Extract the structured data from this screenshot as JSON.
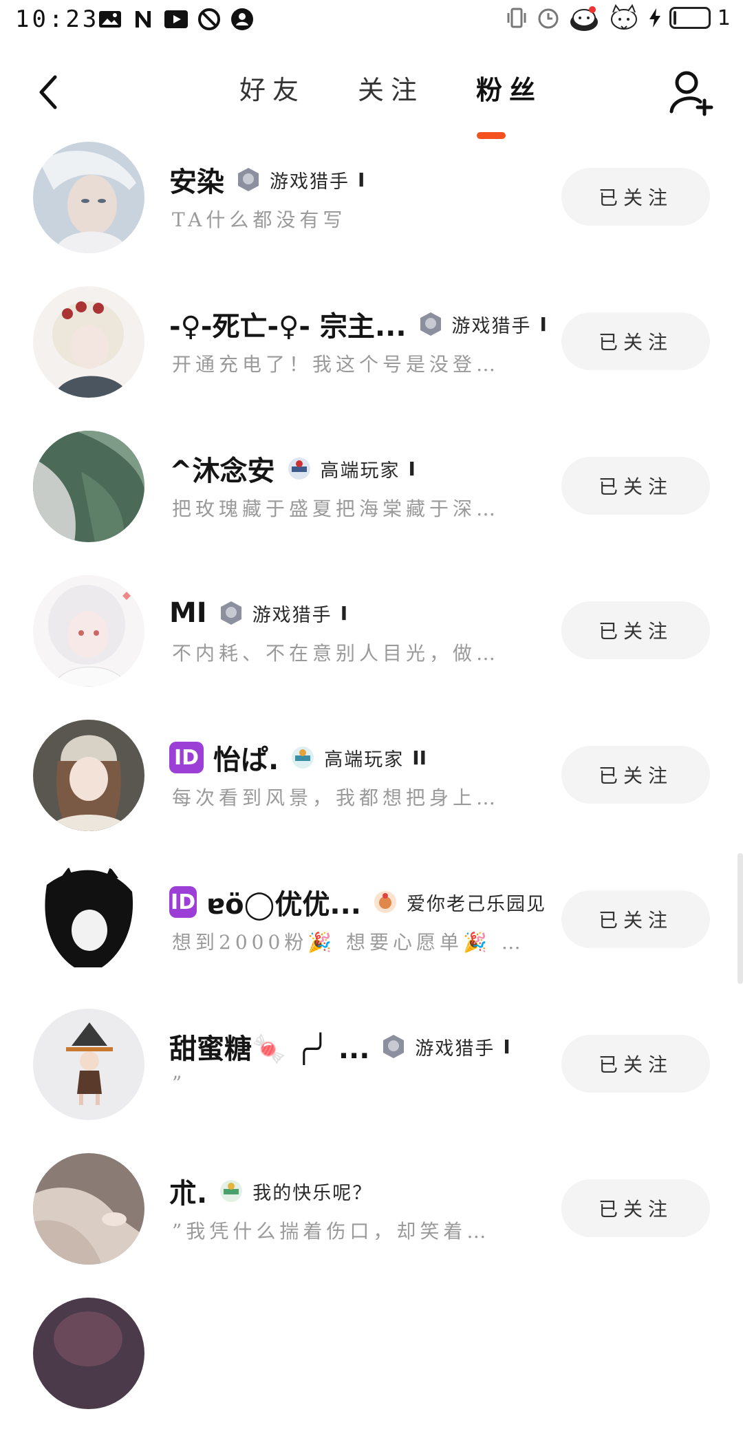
{
  "status_bar": {
    "time": "10:23",
    "battery_level": "1"
  },
  "nav": {
    "tabs": [
      {
        "label": "好友"
      },
      {
        "label": "关注"
      },
      {
        "label": "粉丝"
      }
    ],
    "active_tab": 2
  },
  "follow_label": "已关注",
  "accent_color": "#f4511e",
  "fans": [
    {
      "nickname": "安染",
      "has_id_badge": false,
      "level_tag": "游戏猎手",
      "tag_suffix": "I",
      "bio": "TA什么都没有写",
      "follow": "已关注"
    },
    {
      "nickname": "-♀-死亡-♀- 宗主...",
      "has_id_badge": false,
      "level_tag": "游戏猎手",
      "tag_suffix": "I",
      "bio": "开通充电了！我这个号是没登…",
      "follow": "已关注"
    },
    {
      "nickname": "^沐念安",
      "has_id_badge": false,
      "level_tag": "高端玩家",
      "tag_suffix": "I",
      "bio": "把玫瑰藏于盛夏把海棠藏于深…",
      "follow": "已关注"
    },
    {
      "nickname": "MI",
      "has_id_badge": false,
      "level_tag": "游戏猎手",
      "tag_suffix": "I",
      "bio": "不内耗、不在意别人目光，做…",
      "follow": "已关注"
    },
    {
      "nickname": "怡ぱ.",
      "has_id_badge": true,
      "id_badge": "ID",
      "level_tag": "高端玩家",
      "tag_suffix": "II",
      "bio": "每次看到风景，我都想把身上…",
      "follow": "已关注"
    },
    {
      "nickname": "ɐö◯优优...",
      "has_id_badge": true,
      "id_badge": "ID",
      "level_tag": "爱你老己乐园见",
      "tag_suffix": "",
      "bio": "想到2000粉🎉 想要心愿单🎉 …",
      "follow": "已关注"
    },
    {
      "nickname": "甜蜜糖🍬 ╭╯ ...",
      "has_id_badge": false,
      "level_tag": "游戏猎手",
      "tag_suffix": "I",
      "bio": "”",
      "follow": "已关注"
    },
    {
      "nickname": "朮.",
      "has_id_badge": false,
      "level_tag": "我的快乐呢？",
      "tag_suffix": "",
      "bio": "”我凭什么揣着伤口，却笑着…",
      "follow": "已关注"
    }
  ]
}
